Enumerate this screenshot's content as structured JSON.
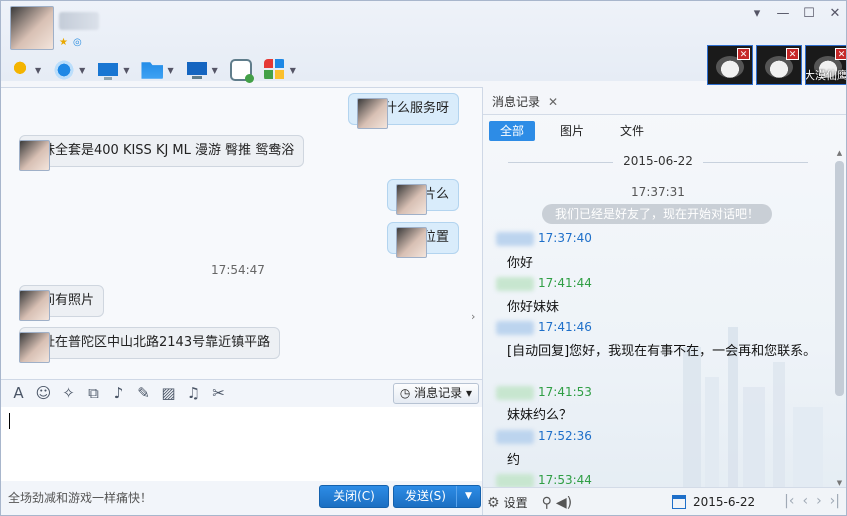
{
  "window": {
    "controls": {
      "menu": "▾",
      "minimize": "—",
      "maximize": "☐",
      "close": "✕"
    }
  },
  "header": {
    "toolbar_icons": [
      "mic-icon",
      "camera-icon",
      "screen-share-icon",
      "file-transfer-icon",
      "remote-desktop-icon",
      "add-message-icon",
      "apps-icon"
    ],
    "contacts_strip_label": "大漠仙鹰"
  },
  "chat": {
    "messages": [
      {
        "side": "right",
        "text": "妹妹什么服务呀"
      },
      {
        "side": "left",
        "text": "妹妹全套是400 KISS KJ ML 漫游 臀推 鸳鸯浴"
      },
      {
        "side": "right",
        "text": "有照片么"
      },
      {
        "side": "right",
        "text": "具体位置"
      },
      {
        "side": "left",
        "text": "空间有照片"
      },
      {
        "side": "left",
        "text": "地址在普陀区中山北路2143号靠近镇平路"
      }
    ],
    "time_separator": "17:54:47",
    "collapse_arrow": "›"
  },
  "input": {
    "tool_icons": [
      "font-icon",
      "emoji-icon",
      "shake-icon",
      "screenshot-icon",
      "voice-icon",
      "edit-icon",
      "image-icon",
      "music-icon",
      "scissors-icon"
    ],
    "history_button": "消息记录",
    "promo": "全场劲减和游戏一样痛快！",
    "close_button": "关闭(C)",
    "send_button": "发送(S)"
  },
  "history": {
    "tab_title": "消息记录",
    "filters": [
      "全部",
      "图片",
      "文件"
    ],
    "active_filter": "全部",
    "date": "2015-06-22",
    "first_time": "17:37:31",
    "system_notice": "我们已经是好友了，现在开始对话吧！",
    "entries": [
      {
        "who": "me",
        "time": "17:37:40",
        "text": "你好"
      },
      {
        "who": "other",
        "time": "17:41:44",
        "text": "你好妹妹"
      },
      {
        "who": "me",
        "time": "17:41:46",
        "text": "[自动回复]您好，我现在有事不在，一会再和您联系。"
      },
      {
        "who": "other",
        "time": "17:41:53",
        "text": "妹妹约么？"
      },
      {
        "who": "me",
        "time": "17:52:36",
        "text": "约"
      },
      {
        "who": "other",
        "time": "17:53:44",
        "text": ""
      }
    ],
    "footer": {
      "settings_label": "设置",
      "date_value": "2015-6-22",
      "pager": [
        "|‹",
        "‹",
        "›",
        "›|"
      ]
    }
  },
  "colors": {
    "accent": "#2d8ce6",
    "my_bubble": "#d9ecfb",
    "their_bubble": "#edf0f4",
    "my_time": "#1e6fc9",
    "their_time": "#2f9e44"
  }
}
